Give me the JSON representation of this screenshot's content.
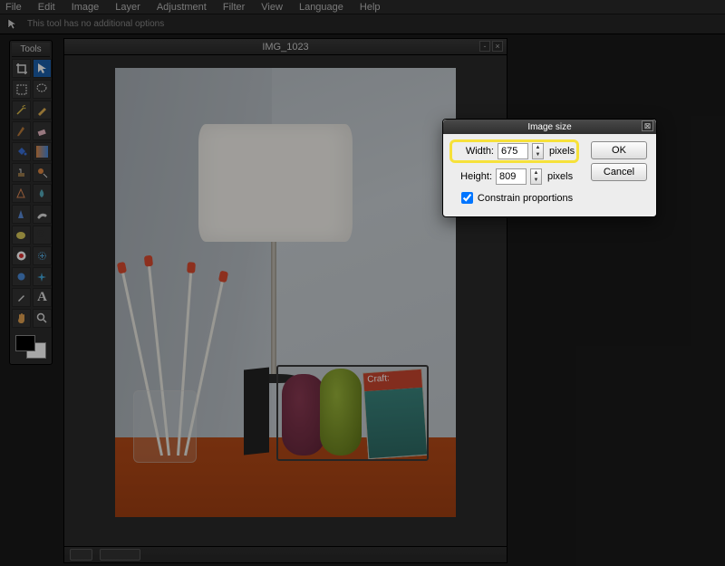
{
  "menu": {
    "items": [
      "File",
      "Edit",
      "Image",
      "Layer",
      "Adjustment",
      "Filter",
      "View",
      "Language",
      "Help"
    ]
  },
  "options_bar": {
    "message": "This tool has no additional options"
  },
  "tools_panel": {
    "title": "Tools"
  },
  "document": {
    "title": "IMG_1023",
    "magazine_title": "Craft:"
  },
  "dialog": {
    "title": "Image size",
    "width_label": "Width:",
    "height_label": "Height:",
    "width_value": "675",
    "height_value": "809",
    "unit": "pixels",
    "constrain_label": "Constrain proportions",
    "constrain_checked": true,
    "ok_label": "OK",
    "cancel_label": "Cancel"
  }
}
